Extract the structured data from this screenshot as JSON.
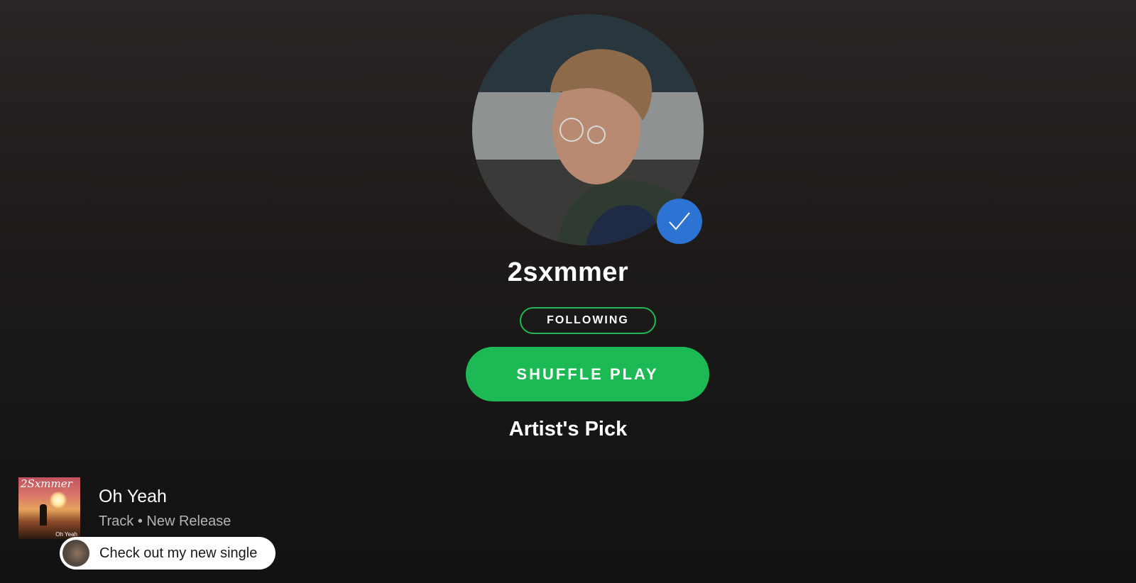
{
  "artist": {
    "name": "2sxmmer",
    "verified": true,
    "follow_label": "FOLLOWING",
    "shuffle_label": "SHUFFLE PLAY"
  },
  "artists_pick": {
    "section_title": "Artist's Pick",
    "track": {
      "title": "Oh Yeah",
      "meta": "Track • New Release",
      "cover_title": "2Sxmmer",
      "cover_subtitle": "Oh Yeah"
    },
    "comment": "Check out my new single"
  },
  "colors": {
    "accent": "#1db954",
    "verified_badge": "#2d73d3",
    "background": "#121212"
  }
}
